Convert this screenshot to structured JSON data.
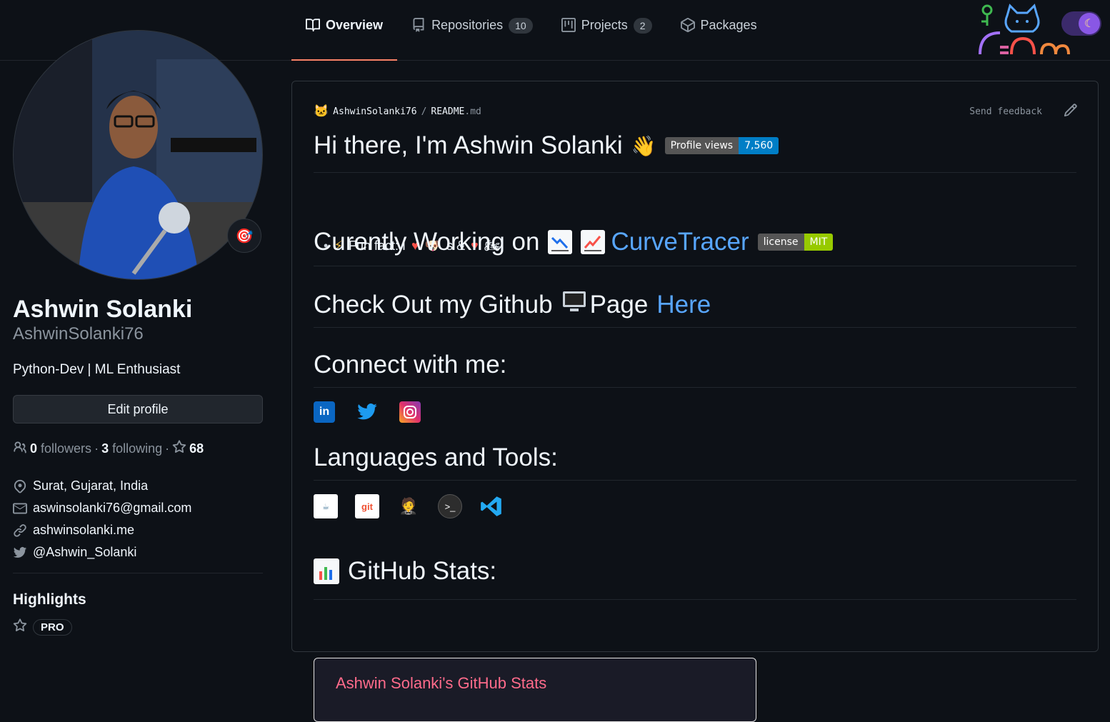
{
  "tabs": [
    {
      "label": "Overview",
      "count": null,
      "icon": "book-icon"
    },
    {
      "label": "Repositories",
      "count": "10",
      "icon": "repo-icon"
    },
    {
      "label": "Projects",
      "count": "2",
      "icon": "project-icon"
    },
    {
      "label": "Packages",
      "count": null,
      "icon": "package-icon"
    }
  ],
  "profile": {
    "name": "Ashwin Solanki",
    "login": "AshwinSolanki76",
    "bio": "Python-Dev | ML Enthusiast",
    "edit_label": "Edit profile",
    "followers": "0",
    "followers_label": "followers",
    "following": "3",
    "following_label": "following",
    "stars": "68",
    "status_emoji": "🎯",
    "location": "Surat, Gujarat, India",
    "email": "aswinsolanki76@gmail.com",
    "website": "ashwinsolanki.me",
    "twitter": "@Ashwin_Solanki",
    "highlights_title": "Highlights",
    "pro_label": "PRO"
  },
  "readme": {
    "owner": "AshwinSolanki76",
    "file": "README",
    "ext": ".md",
    "feedback": "Send feedback",
    "greeting": "Hi there, I'm Ashwin Solanki",
    "greeting_emoji": "👋",
    "views_label": "Profile views",
    "views_value": "7,560",
    "fun_fact": "Fun fact: I",
    "fun_fact_mid": "s &",
    "working_title": "Curently Working on",
    "working_link": "CurveTracer",
    "license_label": "license",
    "license_value": "MIT",
    "github_title_a": "Check Out my Github",
    "github_title_b": "Page",
    "github_link": "Here",
    "connect_title": "Connect with me:",
    "languages_title": "Languages and Tools:",
    "stats_title": "GitHub Stats:",
    "stats_card_title": "Ashwin Solanki's GitHub Stats"
  },
  "colors": {
    "accent": "#f78166",
    "link": "#58a6ff",
    "views_badge": "#007ec6",
    "mit_badge": "#97ca00"
  }
}
